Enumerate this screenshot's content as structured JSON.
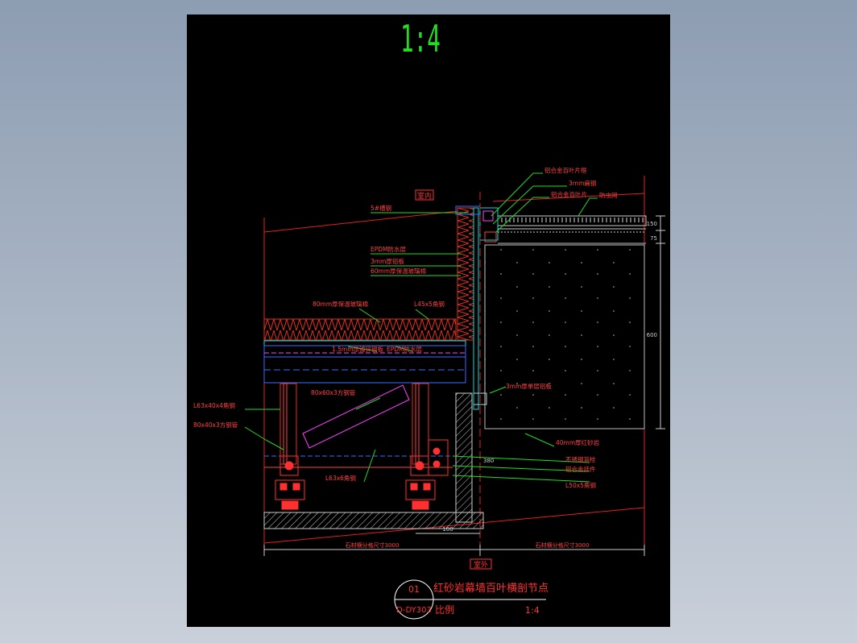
{
  "scale_title": "1:4",
  "zone_labels": {
    "interior": "室内",
    "exterior": "室外"
  },
  "callouts": {
    "c1": "铝合金百叶片框",
    "c2": "3mm扁钢",
    "c3": "铝合金百叶片",
    "c4": "防虫网",
    "c5": "5#槽钢",
    "c6": "EPDM防水层",
    "c7": "3mm厚铝板",
    "c8": "60mm厚保温玻璃棉",
    "c9": "80mm厚保温玻璃棉",
    "c10": "L45x5角钢",
    "c11": "1.5mm厚镀锌钢板",
    "c12": "EPDM防水层",
    "c13": "80x60x3方钢管",
    "c14": "L63x40x4角钢",
    "c15": "80x40x3方钢管",
    "c16": "L63x6角钢",
    "c17": "3mm厚单层铝板",
    "c18": "40mm厚红砂岩",
    "c19": "不锈钢背栓",
    "c20": "铝合金挂件",
    "c21": "L50x5角钢"
  },
  "dimensions": {
    "d_left_bottom": "石材横分格尺寸3000",
    "d_right_bottom": "石材横分格尺寸3000",
    "d_small": "100",
    "d_right_upper": "150",
    "d_right_upper2": "75",
    "d_right_main": "600",
    "d_vertical_mid": "380"
  },
  "title_block": {
    "detail_no": "01",
    "sheet_ref": "D-DY303",
    "title": "红砂岩幕墙百叶横剖节点",
    "scale_label": "比例",
    "scale_value": "1:4"
  }
}
